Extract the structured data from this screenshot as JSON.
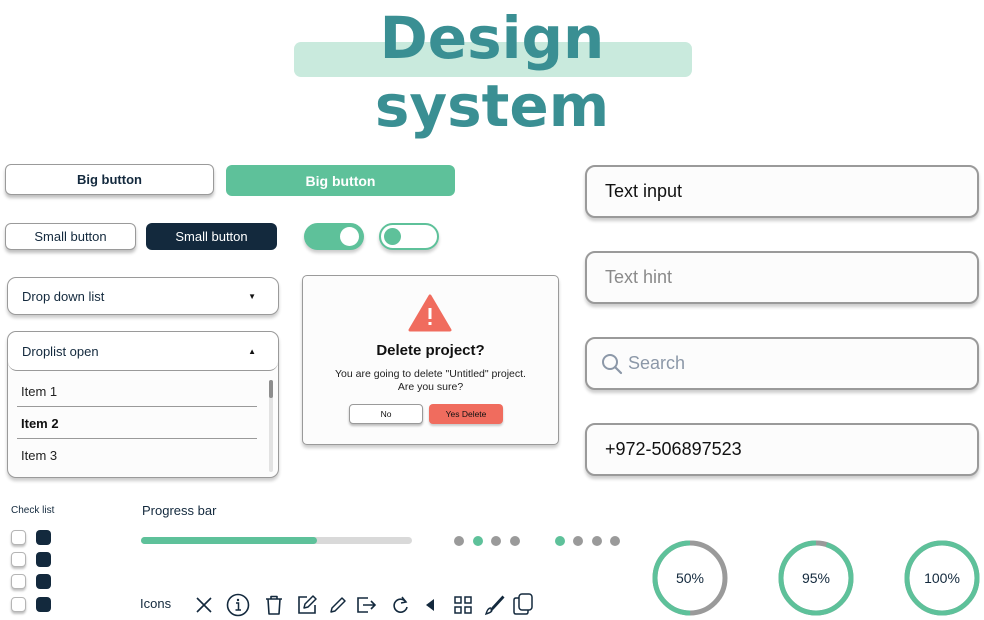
{
  "title": "Design system",
  "colors": {
    "accent": "#5ec19a",
    "dark": "#13293d",
    "title": "#3a8f93",
    "title_highlight": "#c9eadd",
    "danger": "#f06c5e",
    "neutral": "#9a9a9a",
    "track": "#d9d9d9"
  },
  "buttons": {
    "big_outline": "Big button",
    "big_filled": "Big button",
    "small_outline": "Small button",
    "small_dark": "Small button"
  },
  "toggles": [
    {
      "name": "toggle-on",
      "state": "on"
    },
    {
      "name": "toggle-off",
      "state": "off"
    }
  ],
  "dropdown": {
    "label": "Drop down list",
    "icon": "caret-down-icon"
  },
  "droplist": {
    "label": "Droplist open",
    "icon": "caret-up-icon",
    "items": [
      "Item 1",
      "Item 2",
      "Item 3"
    ],
    "selected": "Item 2"
  },
  "dialog": {
    "icon": "warning-icon",
    "title": "Delete project?",
    "message_line1": "You are going to delete \"Untitled\" project.",
    "message_line2": "Are you sure?",
    "no_label": "No",
    "yes_label": "Yes Delete"
  },
  "inputs": {
    "text_input_value": "Text input",
    "text_hint_placeholder": "Text hint",
    "search_placeholder": "Search",
    "phone_value": "+972-506897523"
  },
  "checklist": {
    "label": "Check list",
    "rows": [
      {
        "unchecked": false,
        "checked": true
      },
      {
        "unchecked": false,
        "checked": true
      },
      {
        "unchecked": false,
        "checked": true
      },
      {
        "unchecked": false,
        "checked": true
      }
    ]
  },
  "progress": {
    "label": "Progress bar",
    "value_percent": 65,
    "pager1": {
      "count": 4,
      "active_index": 1
    },
    "pager2": {
      "count": 4,
      "active_index": 0
    }
  },
  "icons": {
    "label": "Icons",
    "list": [
      "close-icon",
      "info-icon",
      "trash-icon",
      "edit-square-icon",
      "pencil-icon",
      "logout-icon",
      "refresh-icon",
      "caret-left-icon",
      "grid-icon",
      "brush-icon",
      "copy-icon"
    ]
  },
  "rings": [
    {
      "label": "50%",
      "value": 50
    },
    {
      "label": "95%",
      "value": 95
    },
    {
      "label": "100%",
      "value": 100
    }
  ]
}
